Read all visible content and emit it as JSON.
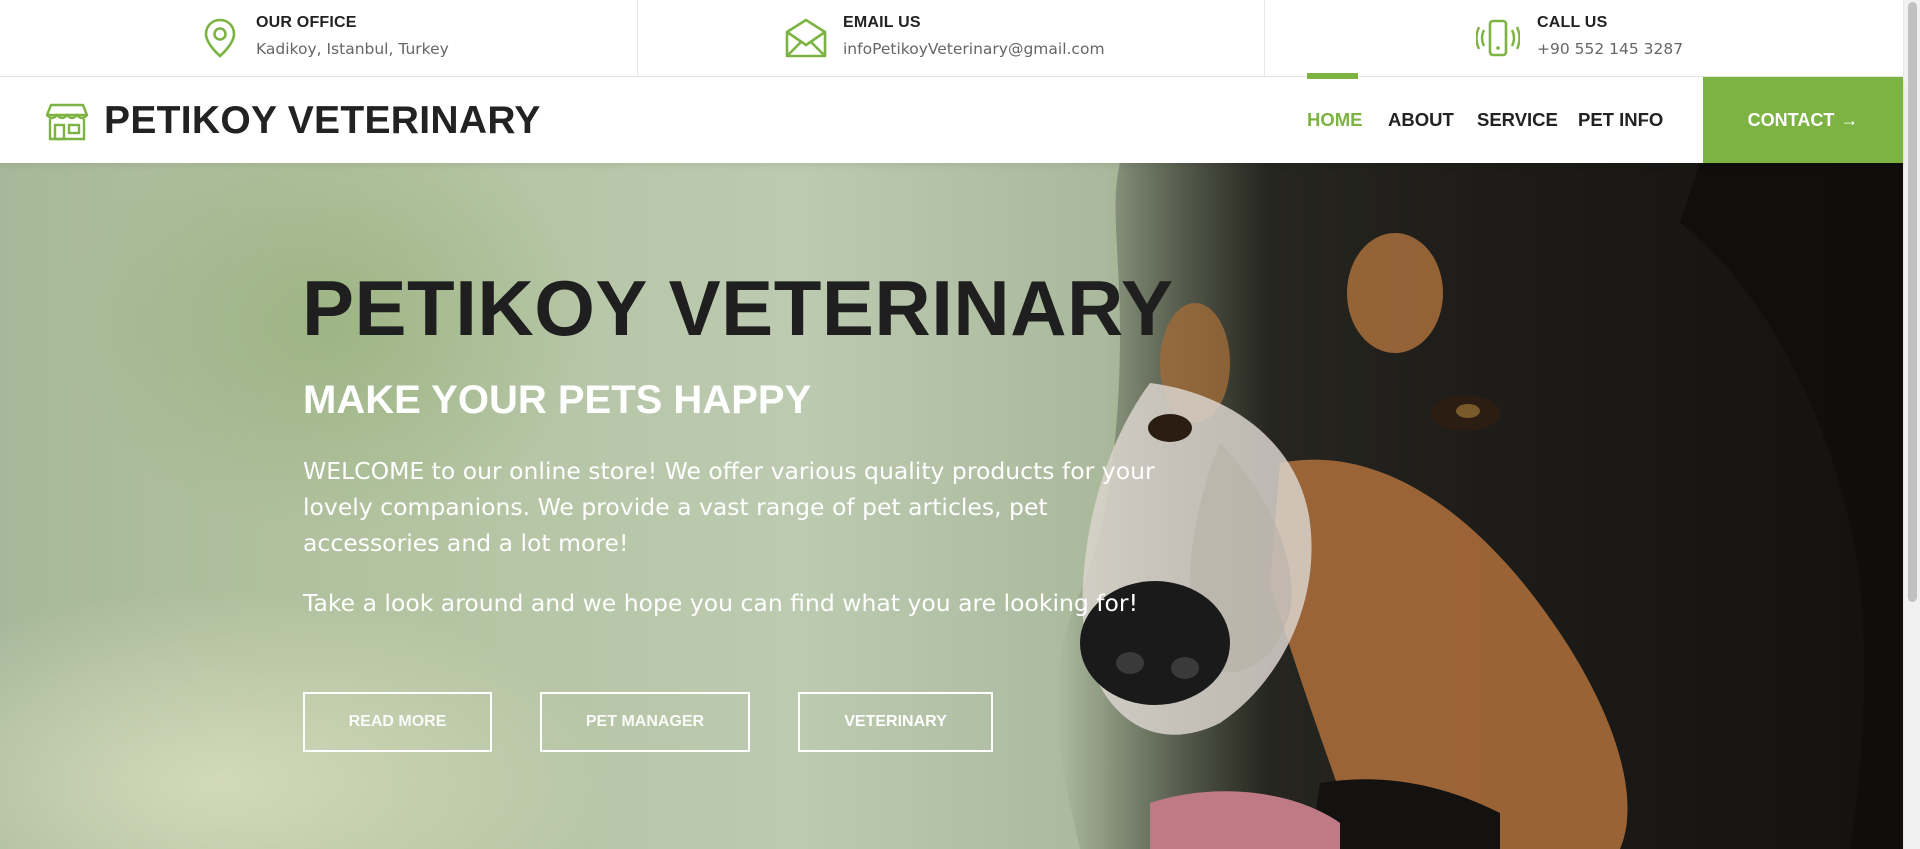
{
  "top_info": [
    {
      "title": "OUR OFFICE",
      "text": "Kadikoy, Istanbul, Turkey",
      "icon": "location-pin-icon"
    },
    {
      "title": "EMAIL US",
      "text": "infoPetikoyVeterinary@gmail.com",
      "icon": "envelope-icon"
    },
    {
      "title": "CALL US",
      "text": "+90 552 145 3287",
      "icon": "vibrating-phone-icon"
    }
  ],
  "brand": {
    "name": "PETIKOY VETERINARY",
    "icon": "storefront-icon"
  },
  "nav": {
    "items": [
      {
        "label": "HOME",
        "active": true
      },
      {
        "label": "ABOUT",
        "active": false
      },
      {
        "label": "SERVICE",
        "active": false
      },
      {
        "label": "PET INFO",
        "active": false
      }
    ],
    "contact_label": "CONTACT",
    "contact_icon": "arrow-right-icon"
  },
  "hero": {
    "title": "PETIKOY VETERINARY",
    "subtitle": "MAKE YOUR PETS HAPPY",
    "paragraph": "WELCOME to our online store! We offer various quality products for your lovely companions. We provide a vast range of pet articles, pet accessories and a lot more!",
    "paragraph2": "Take a look around and we hope you can find what you are looking for!",
    "buttons": [
      "READ MORE",
      "PET MANAGER",
      "VETERINARY"
    ]
  },
  "colors": {
    "accent": "#7cb342",
    "text_dark": "#222222",
    "text_muted": "#666666"
  }
}
